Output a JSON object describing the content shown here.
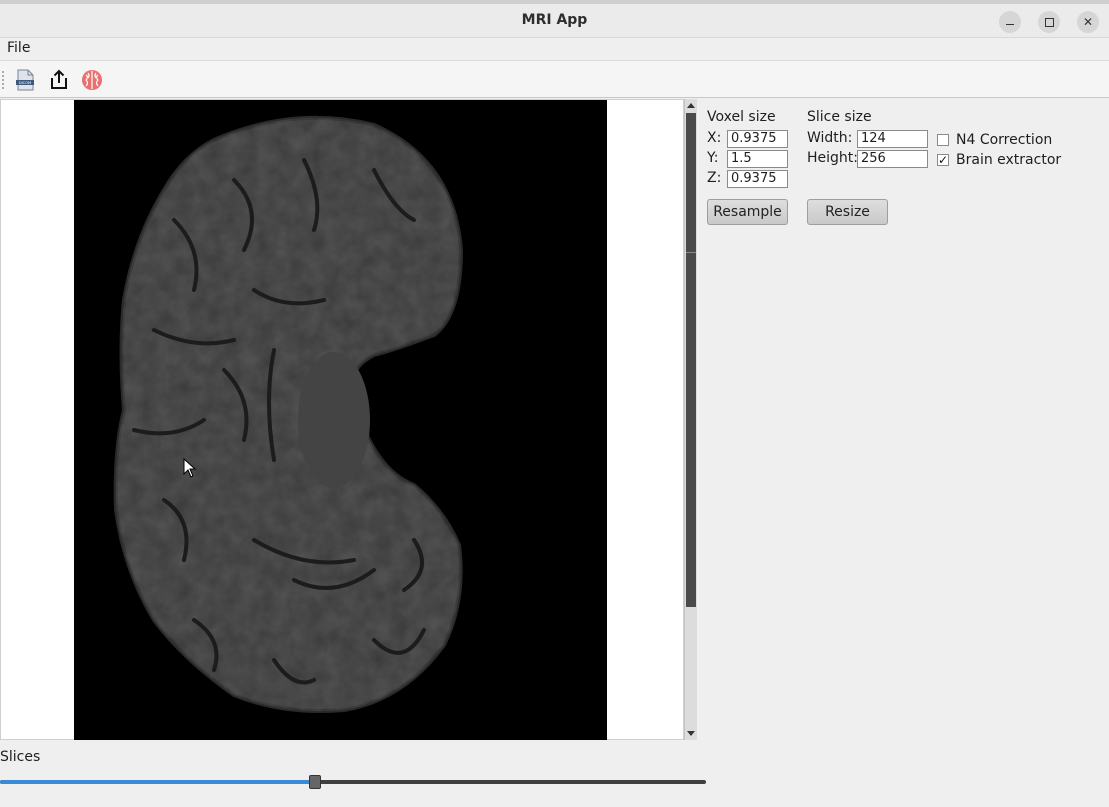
{
  "window": {
    "title": "MRI App"
  },
  "menu": {
    "items": [
      "File"
    ]
  },
  "toolbar": {
    "icons": [
      "dicom-file-icon",
      "export-icon",
      "brain-icon"
    ],
    "dicom_text": "DICOM"
  },
  "panel": {
    "voxel_title": "Voxel size",
    "x_label": "X:",
    "x_value": "0.9375",
    "y_label": "Y:",
    "y_value": "1.5",
    "z_label": "Z:",
    "z_value": "0.9375",
    "slice_title": "Slice size",
    "width_label": "Width:",
    "width_value": "124",
    "height_label": "Height:",
    "height_value": "256",
    "n4_label": "N4 Correction",
    "n4_checked": false,
    "brain_label": "Brain extractor",
    "brain_checked": true,
    "resample_label": "Resample",
    "resize_label": "Resize"
  },
  "slices": {
    "label": "Slices",
    "position": 0.446
  },
  "colors": {
    "accent": "#3a8ad6",
    "brain_icon": "#e8706f"
  }
}
